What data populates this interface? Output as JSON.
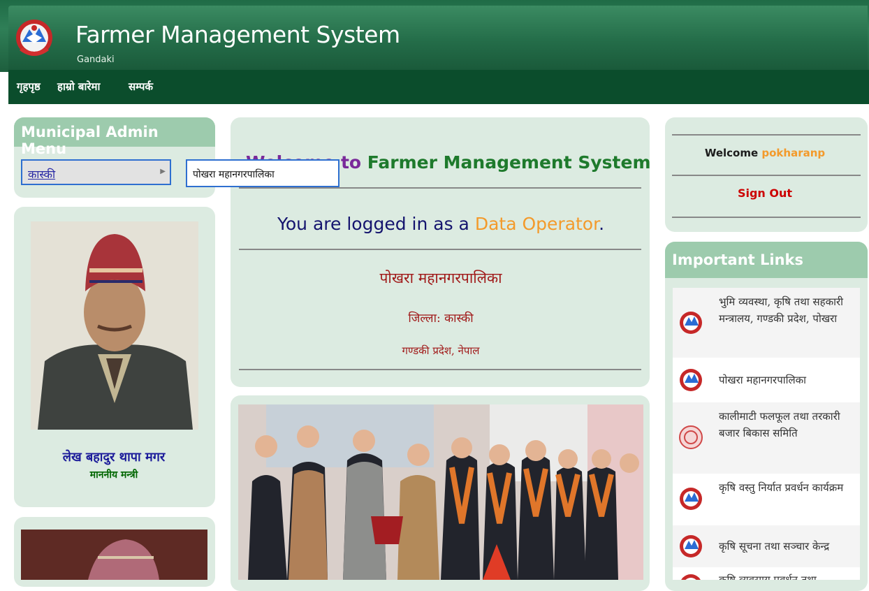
{
  "header": {
    "title": "Farmer Management System",
    "subtitle": "Gandaki"
  },
  "nav": {
    "items": [
      "गृहपृष्ठ",
      "हाम्रो बारेमा",
      "सम्पर्क"
    ]
  },
  "admin_menu": {
    "title": "Municipal Admin Menu",
    "selected": "कास्की",
    "submenu_item": "पोखरा महानगरपालिका"
  },
  "minister": {
    "name": "लेख बहादुर थापा मगर",
    "role": "माननीय मन्त्री"
  },
  "welcome": {
    "heading_prefix": "Welcome",
    "heading_to": "to",
    "heading_system": "Farmer Management System",
    "logged_in_prefix": "You are logged in as a",
    "logged_in_role": "Data Operator",
    "logged_in_suffix": ".",
    "municipality": "पोखरा महानगरपालिका",
    "district": "जिल्ला: कास्की",
    "province": "गण्डकी प्रदेश, नेपाल"
  },
  "user_box": {
    "welcome_label": "Welcome",
    "username": "pokharanp",
    "signout": "Sign Out"
  },
  "important_links": {
    "title": "Important Links",
    "items": [
      "भुमि व्यवस्था, कृषि तथा सहकारी मन्त्रालय, गण्डकी प्रदेश, पोखरा",
      "पोखरा महानगरपालिका",
      "कालीमाटी फलफूल तथा तरकारी बजार बिकास समिति",
      "कृषि वस्तु निर्यात प्रवर्धन कार्यक्रम",
      "कृषि सूचना तथा सञ्चार केन्द्र",
      "कृषि व्यवसाय प्रवर्धन तथा"
    ]
  },
  "colors": {
    "header_green": "#246d49",
    "nav_green": "#0b4d2c",
    "panel_bg": "#dcebe1",
    "panel_title": "#9dcbad",
    "accent_orange": "#f39a2b",
    "signout_red": "#cc0000"
  }
}
